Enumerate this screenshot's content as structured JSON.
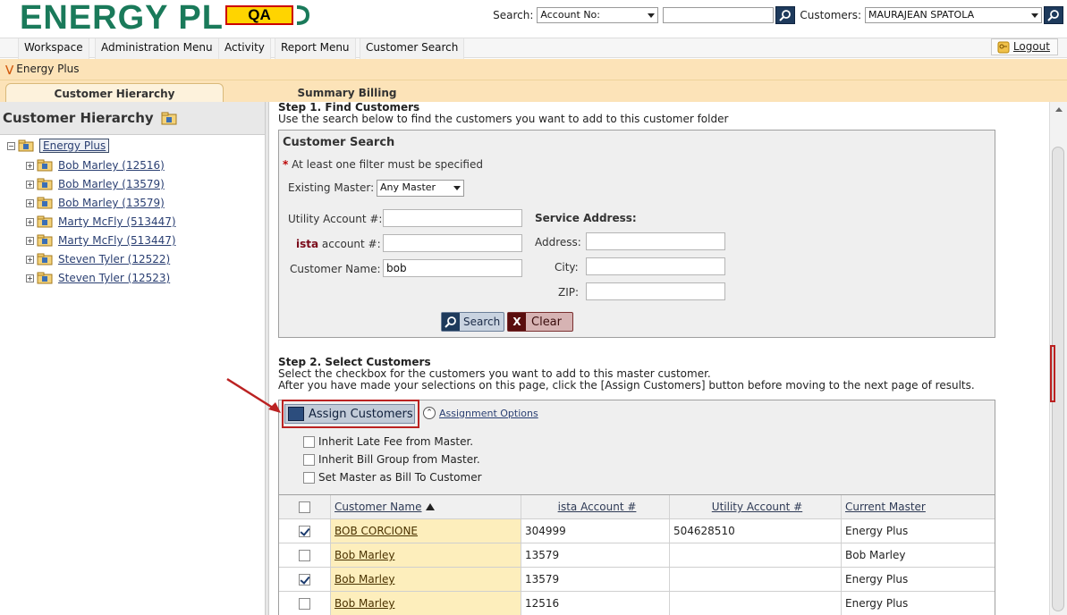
{
  "header": {
    "logo_text": "ENERGY PL",
    "env_badge": "QA",
    "search_label": "Search:",
    "search_type": "Account No:",
    "search_value": "",
    "customers_label": "Customers:",
    "customer_selected": "MAURAJEAN SPATOLA"
  },
  "nav": {
    "items": [
      "Workspace",
      "Administration Menu",
      "Activity",
      "Report Menu",
      "Customer Search"
    ],
    "logout": "Logout"
  },
  "breadcrumb": "Energy Plus",
  "tabs": {
    "active": "Customer Hierarchy",
    "inactive": "Summary Billing"
  },
  "left_panel": {
    "title": "Customer Hierarchy",
    "root": "Energy Plus",
    "children": [
      "Bob Marley (12516)",
      "Bob Marley (13579)",
      "Bob Marley (13579)",
      "Marty McFly (513447)",
      "Marty McFly (513447)",
      "Steven Tyler (12522)",
      "Steven Tyler (12523)"
    ]
  },
  "step1": {
    "title": "Step 1. Find Customers",
    "desc": "Use the search below to find the customers you want to add to this customer folder"
  },
  "search_form": {
    "title": "Customer Search",
    "required_star": "*",
    "required_note": "At least one filter must be specified",
    "existing_master_label": "Existing Master:",
    "existing_master_value": "Any Master",
    "utility_account_label": "Utility Account #:",
    "utility_account_value": "",
    "ista_brand": "ista",
    "ista_account_label": "account #:",
    "ista_account_value": "",
    "customer_name_label": "Customer Name:",
    "customer_name_value": "bob",
    "service_address_heading": "Service Address:",
    "address_label": "Address:",
    "address_value": "",
    "city_label": "City:",
    "city_value": "",
    "zip_label": "ZIP:",
    "zip_value": "",
    "search_button": "Search",
    "clear_button": "Clear"
  },
  "step2": {
    "title": "Step 2. Select Customers",
    "desc1": "Select the checkbox for the customers you want to add to this master customer.",
    "desc2": "After you have made your selections on this page, click the [Assign Customers] button before moving to the next page of results."
  },
  "assign": {
    "button": "Assign Customers",
    "options_link": "Assignment Options",
    "options": [
      "Inherit Late Fee from Master.",
      "Inherit Bill Group from Master.",
      "Set Master as Bill To Customer"
    ]
  },
  "grid": {
    "headers": [
      "Customer Name",
      "ista Account #",
      "Utility Account #",
      "Current Master"
    ],
    "rows": [
      {
        "checked": true,
        "name": "BOB CORCIONE",
        "ista": "304999",
        "utility": "504628510",
        "master": "Energy Plus"
      },
      {
        "checked": false,
        "name": "Bob Marley",
        "ista": "13579",
        "utility": "",
        "master": "Bob Marley"
      },
      {
        "checked": true,
        "name": "Bob Marley",
        "ista": "13579",
        "utility": "",
        "master": "Energy Plus"
      },
      {
        "checked": false,
        "name": "Bob Marley",
        "ista": "12516",
        "utility": "",
        "master": "Energy Plus"
      }
    ]
  },
  "colors": {
    "brand_green": "#1a7a5a",
    "band_orange": "#fce3b8",
    "highlight_red": "#bb2222"
  }
}
